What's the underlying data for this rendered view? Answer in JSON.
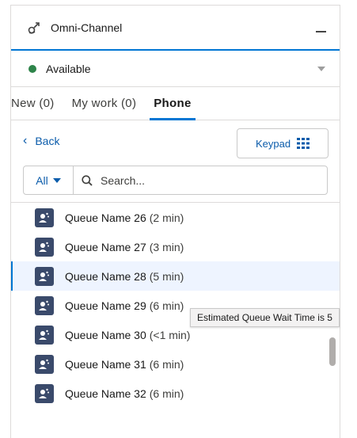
{
  "header": {
    "title": "Omni-Channel",
    "icon": "omni-channel-icon"
  },
  "status": {
    "label": "Available",
    "color": "#2e844a"
  },
  "tabs": [
    {
      "label": "New (0)",
      "active": false
    },
    {
      "label": "My work (0)",
      "active": false
    },
    {
      "label": "Phone",
      "active": true
    }
  ],
  "toolbar": {
    "back_label": "Back",
    "keypad_label": "Keypad"
  },
  "search": {
    "filter_label": "All",
    "placeholder": "Search..."
  },
  "queues": [
    {
      "name": "Queue Name 26",
      "wait": "(2 min)"
    },
    {
      "name": "Queue Name 27",
      "wait": "(3 min)"
    },
    {
      "name": "Queue Name 28",
      "wait": "(5 min)"
    },
    {
      "name": "Queue Name 29",
      "wait": "(6 min)"
    },
    {
      "name": "Queue Name 30",
      "wait": "(<1 min)"
    },
    {
      "name": "Queue Name 31",
      "wait": "(6 min)"
    },
    {
      "name": "Queue Name 32",
      "wait": "(6 min)"
    }
  ],
  "tooltip": {
    "text": "Estimated Queue Wait Time is 5"
  },
  "colors": {
    "accent": "#0176d3",
    "link": "#0b5cab",
    "queue_icon_bg": "#3a4a6b"
  }
}
